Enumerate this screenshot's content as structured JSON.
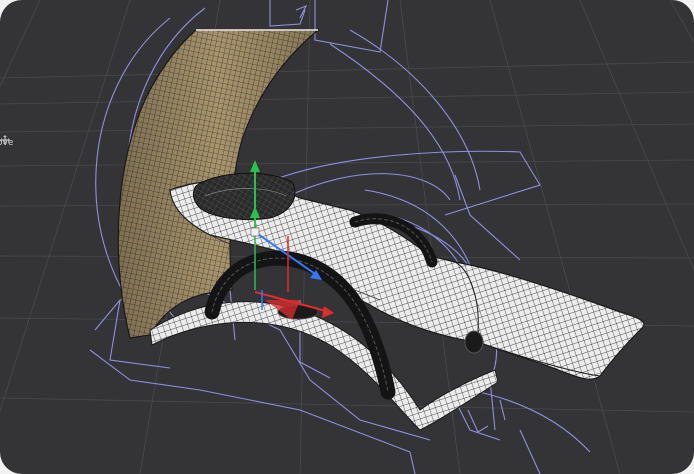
{
  "viewport": {
    "tool_label": "ove",
    "tool_icon": "move-arrows-icon"
  },
  "colors": {
    "background": "#343436",
    "grid": "#4a4a4d",
    "curves": "#8f8fe0",
    "mesh_light": "#e9e9e9",
    "mesh_wire": "#1c1c1c",
    "canopy_tan": "#a8946c",
    "axis_x": "#e22b2b",
    "axis_y": "#27c24a",
    "axis_z": "#2f7bff"
  }
}
